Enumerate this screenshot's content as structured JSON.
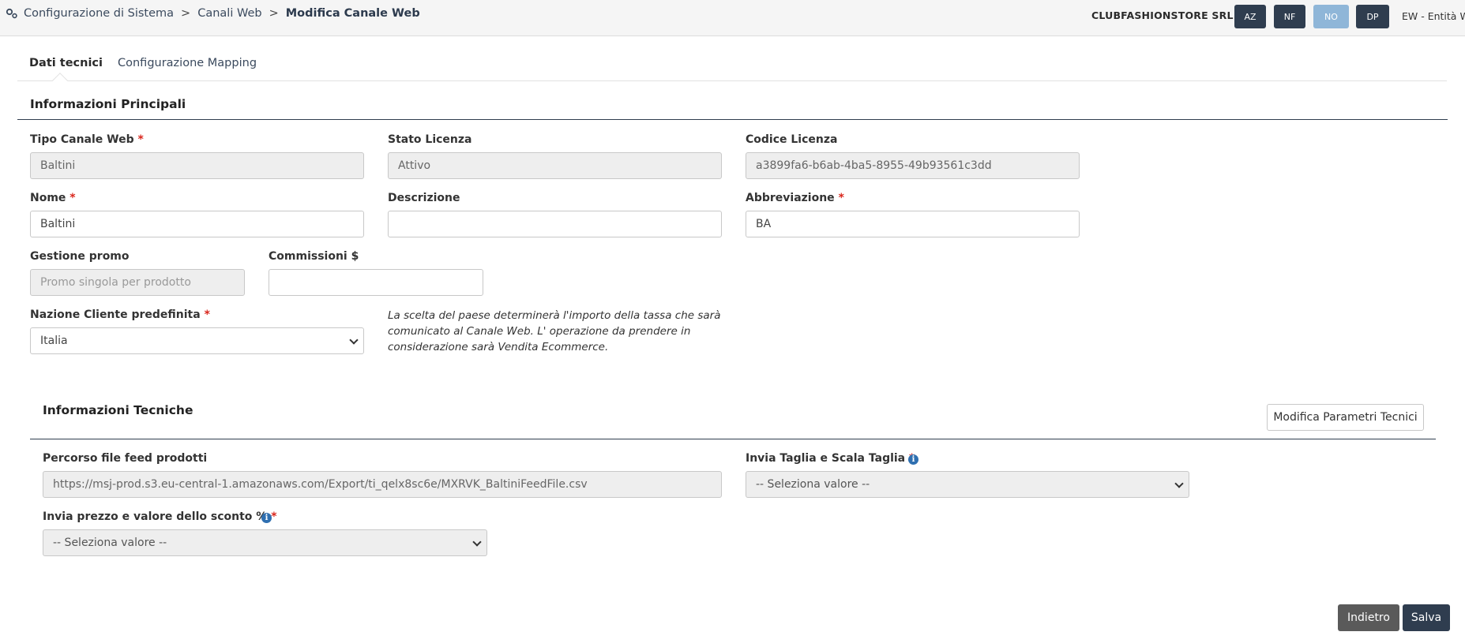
{
  "header": {
    "breadcrumb": [
      "Configurazione di Sistema",
      "Canali Web",
      "Modifica Canale Web"
    ],
    "breadcrumb_separator": ">",
    "company": "CLUBFASHIONSTORE SRL",
    "badges": [
      "AZ",
      "NF",
      "NO",
      "DP"
    ],
    "entity": "EW - Entità Web"
  },
  "tabs": [
    "Dati tecnici",
    "Configurazione Mapping"
  ],
  "main_info": {
    "title": "Informazioni Principali",
    "tipo_canale_label": "Tipo Canale Web",
    "tipo_canale_value": "Baltini",
    "stato_licenza_label": "Stato Licenza",
    "stato_licenza_value": "Attivo",
    "codice_licenza_label": "Codice Licenza",
    "codice_licenza_value": "a3899fa6-b6ab-4ba5-8955-49b93561c3dd",
    "nome_label": "Nome",
    "nome_value": "Baltini",
    "descrizione_label": "Descrizione",
    "descrizione_value": "",
    "abbreviazione_label": "Abbreviazione",
    "abbreviazione_value": "BA",
    "gestione_promo_label": "Gestione promo",
    "gestione_promo_placeholder": "Promo singola per prodotto",
    "commissioni_label": "Commissioni $",
    "commissioni_value": "",
    "nazione_label": "Nazione Cliente predefinita",
    "nazione_value": "Italia",
    "nazione_note": [
      "La scelta del paese determinerà l'importo della tassa che sarà",
      "comunicato al Canale Web. L' operazione da prendere in",
      "considerazione sarà Vendita Ecommerce."
    ]
  },
  "tech_info": {
    "title": "Informazioni Tecniche",
    "edit_button": "Modifica Parametri Tecnici",
    "feed_label": "Percorso file feed prodotti",
    "feed_value": "https://msj-prod.s3.eu-central-1.amazonaws.com/Export/ti_qelx8sc6e/MXRVK_BaltiniFeedFile.csv",
    "taglia_label": "Invia Taglia e Scala Taglia",
    "taglia_value": "-- Seleziona valore --",
    "prezzo_label": "Invia prezzo e valore dello sconto %",
    "prezzo_value": "-- Seleziona valore --"
  },
  "footer": {
    "back_button": "Indietro",
    "save_button": "Salva"
  },
  "required_mark": "*",
  "info_glyph": "i",
  "colors": {
    "primary_dark": "#2f3d4f",
    "badge_light": "#8fb6d8",
    "required": "#d9261c",
    "info": "#2f6fb0",
    "back_button": "#5a5a5a"
  }
}
